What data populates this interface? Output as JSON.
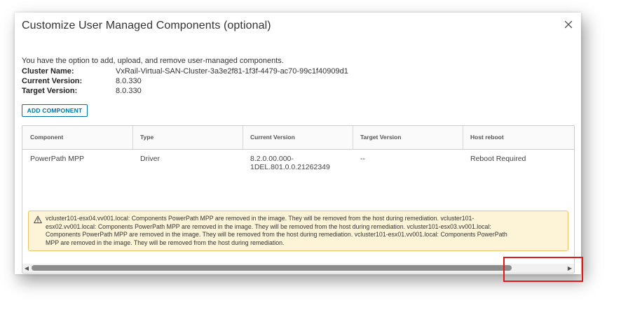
{
  "dialog": {
    "title": "Customize User Managed Components (optional)",
    "intro": "You have the option to add, upload, and remove user-managed components.",
    "info": [
      {
        "label": "Cluster Name:",
        "value": "VxRail-Virtual-SAN-Cluster-3a3e2f81-1f3f-4479-ac70-99c1f40909d1"
      },
      {
        "label": "Current Version:",
        "value": "8.0.330"
      },
      {
        "label": "Target Version:",
        "value": "8.0.330"
      }
    ],
    "add_button": "ADD COMPONENT"
  },
  "grid": {
    "columns": [
      "Component",
      "Type",
      "Current Version",
      "Target Version",
      "Host reboot"
    ],
    "rows": [
      {
        "component": "PowerPath MPP",
        "type": "Driver",
        "current_version_line1": "8.2.0.00.000-",
        "current_version_line2": "1DEL.801.0.0.21262349",
        "target_version": "--",
        "host_reboot": "Reboot Required"
      }
    ],
    "warning": {
      "lines": [
        "vcluster101-esx04.vv001.local: Components PowerPath MPP are removed in the image. They will be removed from the host during remediation. vcluster101-",
        "esx02.vv001.local: Components PowerPath MPP are removed in the image. They will be removed from the host during remediation. vcluster101-esx03.vv001.local:",
        "Components PowerPath MPP are removed in the image. They will be removed from the host during remediation. vcluster101-esx01.vv001.local: Components PowerPath",
        "MPP are removed in the image. They will be removed from the host during remediation."
      ]
    },
    "scrollbar": {
      "position_fraction": 0.0,
      "visible_fraction": 0.9
    }
  },
  "colors": {
    "accent": "#0072a3",
    "warning_bg": "#fdf4d7",
    "warning_border": "#e9c46a",
    "highlight": "#e01a1a"
  },
  "icons": {
    "close": "close-icon",
    "warning": "warning-triangle-icon",
    "scroll_left": "caret-left-icon",
    "scroll_right": "caret-right-icon"
  }
}
